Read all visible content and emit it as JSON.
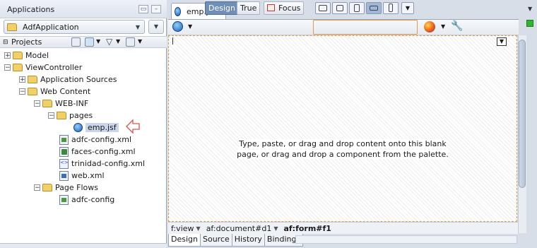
{
  "applications_panel": {
    "title": "Applications",
    "app_selector": {
      "value": "AdfApplication"
    },
    "projects_label": "Projects"
  },
  "tree": [
    {
      "label": "Model",
      "level": 0,
      "kind": "folder",
      "expander": "+"
    },
    {
      "label": "ViewController",
      "level": 0,
      "kind": "folder",
      "expander": "-"
    },
    {
      "label": "Application Sources",
      "level": 1,
      "kind": "folder",
      "expander": "+"
    },
    {
      "label": "Web Content",
      "level": 1,
      "kind": "folder",
      "expander": "-"
    },
    {
      "label": "WEB-INF",
      "level": 2,
      "kind": "folder",
      "expander": "-"
    },
    {
      "label": "pages",
      "level": 3,
      "kind": "folder",
      "expander": "-"
    },
    {
      "label": "emp.jsf",
      "level": 4,
      "kind": "jsf",
      "selected": true
    },
    {
      "label": "adfc-config.xml",
      "level": 3,
      "kind": "xml"
    },
    {
      "label": "faces-config.xml",
      "level": 3,
      "kind": "faces"
    },
    {
      "label": "trinidad-config.xml",
      "level": 3,
      "kind": "trin"
    },
    {
      "label": "web.xml",
      "level": 3,
      "kind": "web"
    },
    {
      "label": "Page Flows",
      "level": 2,
      "kind": "folder",
      "expander": "-"
    },
    {
      "label": "adfc-config",
      "level": 3,
      "kind": "flow"
    }
  ],
  "editor": {
    "tab_label": "emp.jsf",
    "toolbar": {
      "design_label": "Design",
      "true_label": "True",
      "focus_label": "Focus"
    },
    "canvas_message_line1": "Type, paste, or drag and drop content onto this blank",
    "canvas_message_line2": "page, or drag and drop a component from the palette.",
    "breadcrumb": [
      "f:view",
      "af:document#d1",
      "af:form#f1"
    ],
    "bottom_tabs": [
      "Design",
      "Source",
      "History",
      "Bindings"
    ]
  },
  "colors": {
    "accent": "#6f8fb9",
    "canvas_border": "#e39a4a",
    "arrow": "#d9534f"
  }
}
